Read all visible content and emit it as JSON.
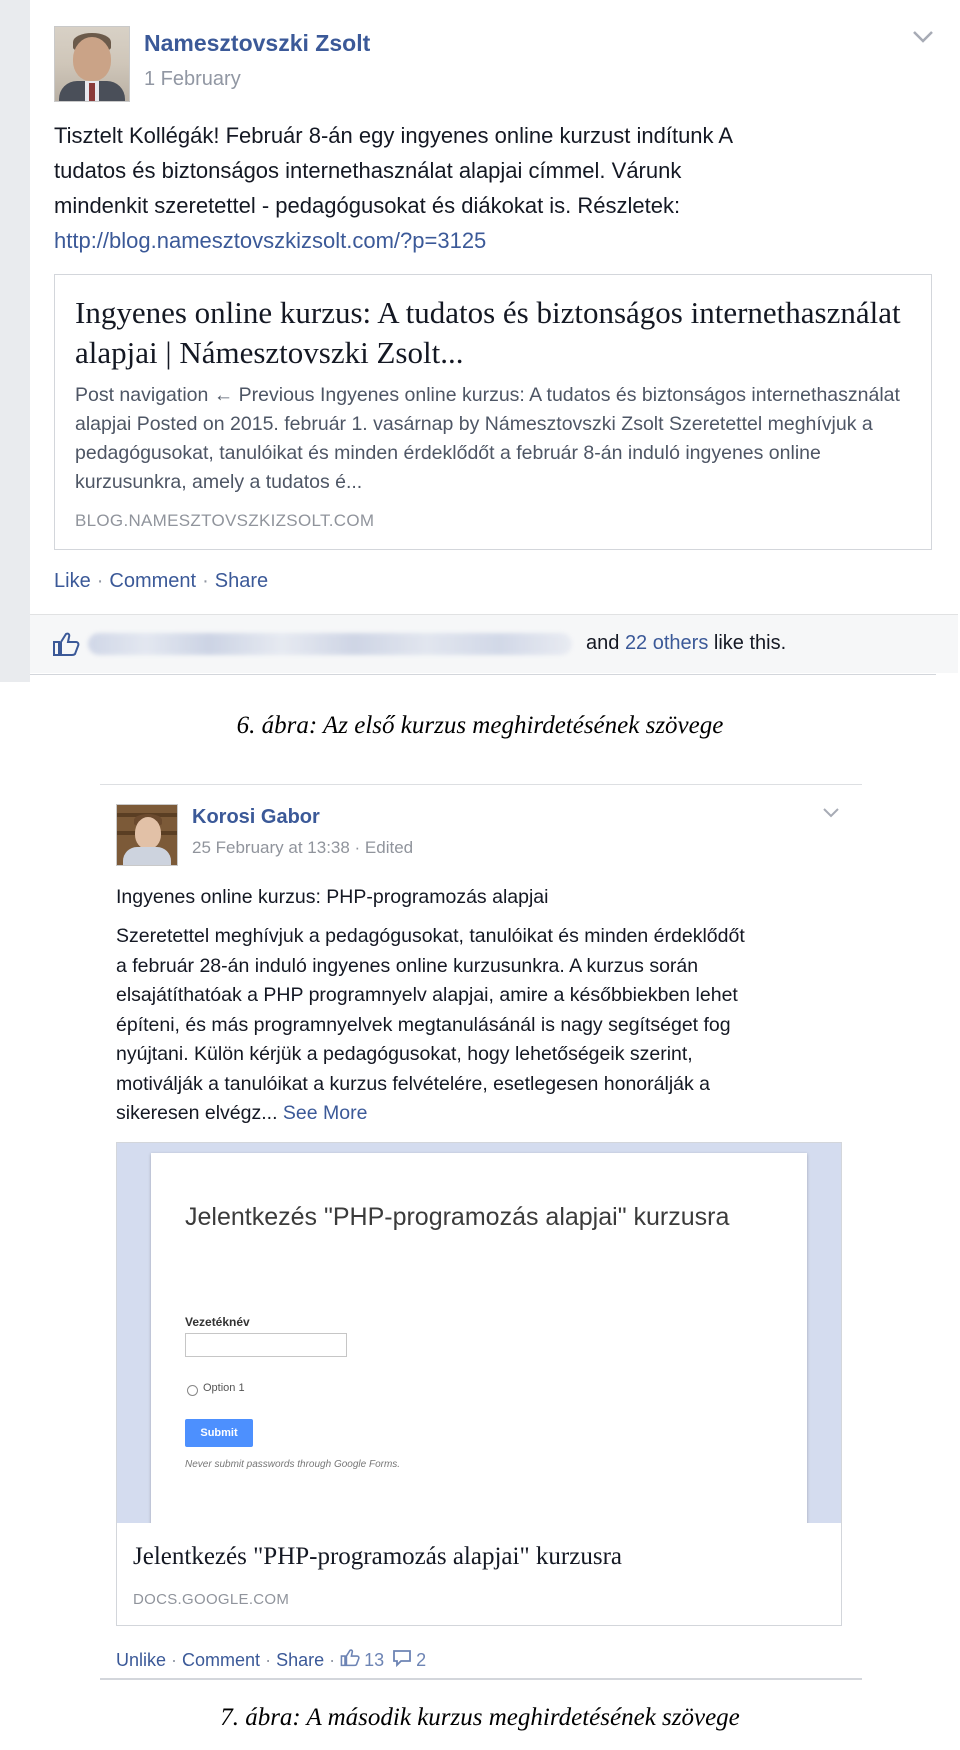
{
  "post1": {
    "author": "Namesztovszki Zsolt",
    "date": "1 February",
    "text_lines": [
      "Tisztelt Kollégák! Február 8-án egy ingyenes online kurzust indítunk A",
      "tudatos és biztonságos internethasználat alapjai címmel. Várunk",
      "mindenkit szeretettel - pedagógusokat és diákokat is. Részletek:"
    ],
    "link_url": "http://blog.namesztovszkizsolt.com/?p=3125",
    "card": {
      "title": "Ingyenes online kurzus: A tudatos és biztonságos internethasználat alapjai | Námesztovszki Zsolt...",
      "description": "Post navigation ← Previous Ingyenes online kurzus: A tudatos és biztonságos internethasználat alapjai Posted on 2015. február 1. vasárnap by Námesztovszki Zsolt Szeretettel meghívjuk a pedagógusokat, tanulóikat és minden érdeklődőt a február 8-án induló ingyenes online kurzusunkra, amely a tudatos é...",
      "domain": "BLOG.NAMESZTOVSZKIZSOLT.COM"
    },
    "actions": {
      "like": "Like",
      "comment": "Comment",
      "share": "Share",
      "separator": "·"
    },
    "likes": {
      "prefix": "and",
      "others": "22 others",
      "suffix": "like this."
    }
  },
  "caption1": "6. ábra: Az első kurzus meghirdetésének szövege",
  "post2": {
    "author": "Korosi Gabor",
    "date": "25 February at 13:38 · Edited",
    "headline": "Ingyenes online kurzus: PHP-programozás alapjai",
    "body_lines": [
      "Szeretettel meghívjuk a pedagógusokat, tanulóikat és minden érdeklődőt",
      "a február 28-án induló ingyenes online kurzusunkra. A kurzus során",
      "elsajátíthatóak a PHP programnyelv alapjai, amire a későbbiekben lehet",
      "építeni, és más programnyelvek megtanulásánál is nagy segítséget fog",
      "nyújtani. Külön kérjük a pedagógusokat, hogy lehetőségeik szerint,",
      "motiválják a tanulóikat a kurzus felvételére, esetlegesen honorálják a"
    ],
    "body_last": "sikeresen elvégz...",
    "see_more": "See More",
    "form_preview": {
      "title": "Jelentkezés \"PHP-programozás alapjai\" kurzusra",
      "field_label": "Vezetéknév",
      "option": "Option 1",
      "submit": "Submit",
      "note": "Never submit passwords through Google Forms."
    },
    "card": {
      "title": "Jelentkezés \"PHP-programozás alapjai\" kurzusra",
      "domain": "DOCS.GOOGLE.COM"
    },
    "actions": {
      "unlike": "Unlike",
      "comment": "Comment",
      "share": "Share",
      "separator": "·",
      "like_count": "13",
      "comment_count": "2"
    }
  },
  "caption2": "7. ábra: A második kurzus meghirdetésének szövege",
  "colors": {
    "link": "#3b5998",
    "muted": "#90949c",
    "form_button": "#4d90fe",
    "preview_bg": "#d4dcef"
  },
  "icons": [
    "chevron-down-icon",
    "thumbs-up-icon",
    "comment-icon"
  ]
}
